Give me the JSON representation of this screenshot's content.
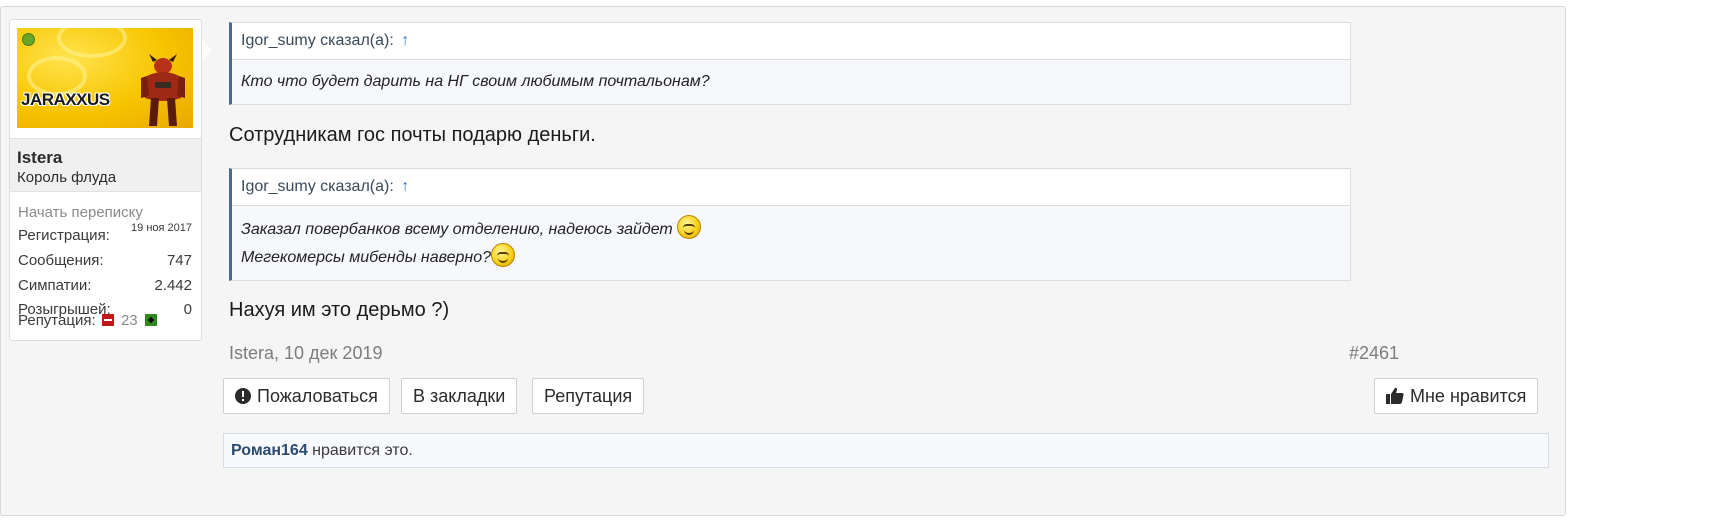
{
  "user": {
    "avatar_text": "JARAXXUS",
    "name": "Istera",
    "title": "Король флуда",
    "start_conversation": "Начать переписку",
    "stats": [
      {
        "label": "Регистрация:",
        "value": "19 ноя 2017"
      },
      {
        "label": "Сообщения:",
        "value": "747"
      },
      {
        "label": "Симпатии:",
        "value": "2.442"
      },
      {
        "label": "Розыгрышей:",
        "value": "0"
      }
    ],
    "reputation_label": "Репутация:",
    "reputation_value": "23"
  },
  "quotes": [
    {
      "author": "Igor_sumy сказал(а):",
      "arrow": "↑",
      "lines": [
        "Кто что будет дарить на НГ своим любимым почтальонам?"
      ]
    },
    {
      "author": "Igor_sumy сказал(а):",
      "arrow": "↑",
      "lines": [
        "Заказал повербанков всему отделению, надеюсь зайдет",
        "Мегекомерсы мибенды наверно?"
      ]
    }
  ],
  "messages": [
    "Сотрудникам гос почты подарю деньги.",
    "Нахуя им это дерьмо ?)"
  ],
  "meta": {
    "author_date": "Istera, 10 дек 2019",
    "post_number": "#2461"
  },
  "actions": {
    "report": "Пожаловаться",
    "bookmark": "В закладки",
    "reputation": "Репутация",
    "like": "Мне нравится"
  },
  "likes": {
    "user": "Роман164",
    "text": " нравится это."
  },
  "colors": {
    "quote_border": "#4b6b8a",
    "link": "#3a78c3",
    "liker": "#2c4a6e",
    "rep_minus": "#c01818",
    "rep_plus": "#2f8a1e"
  },
  "icons": {
    "report": "exclamation-circle-icon",
    "like": "thumbs-up-icon",
    "online": "online-dot-icon",
    "smiley": "smile-icon"
  }
}
